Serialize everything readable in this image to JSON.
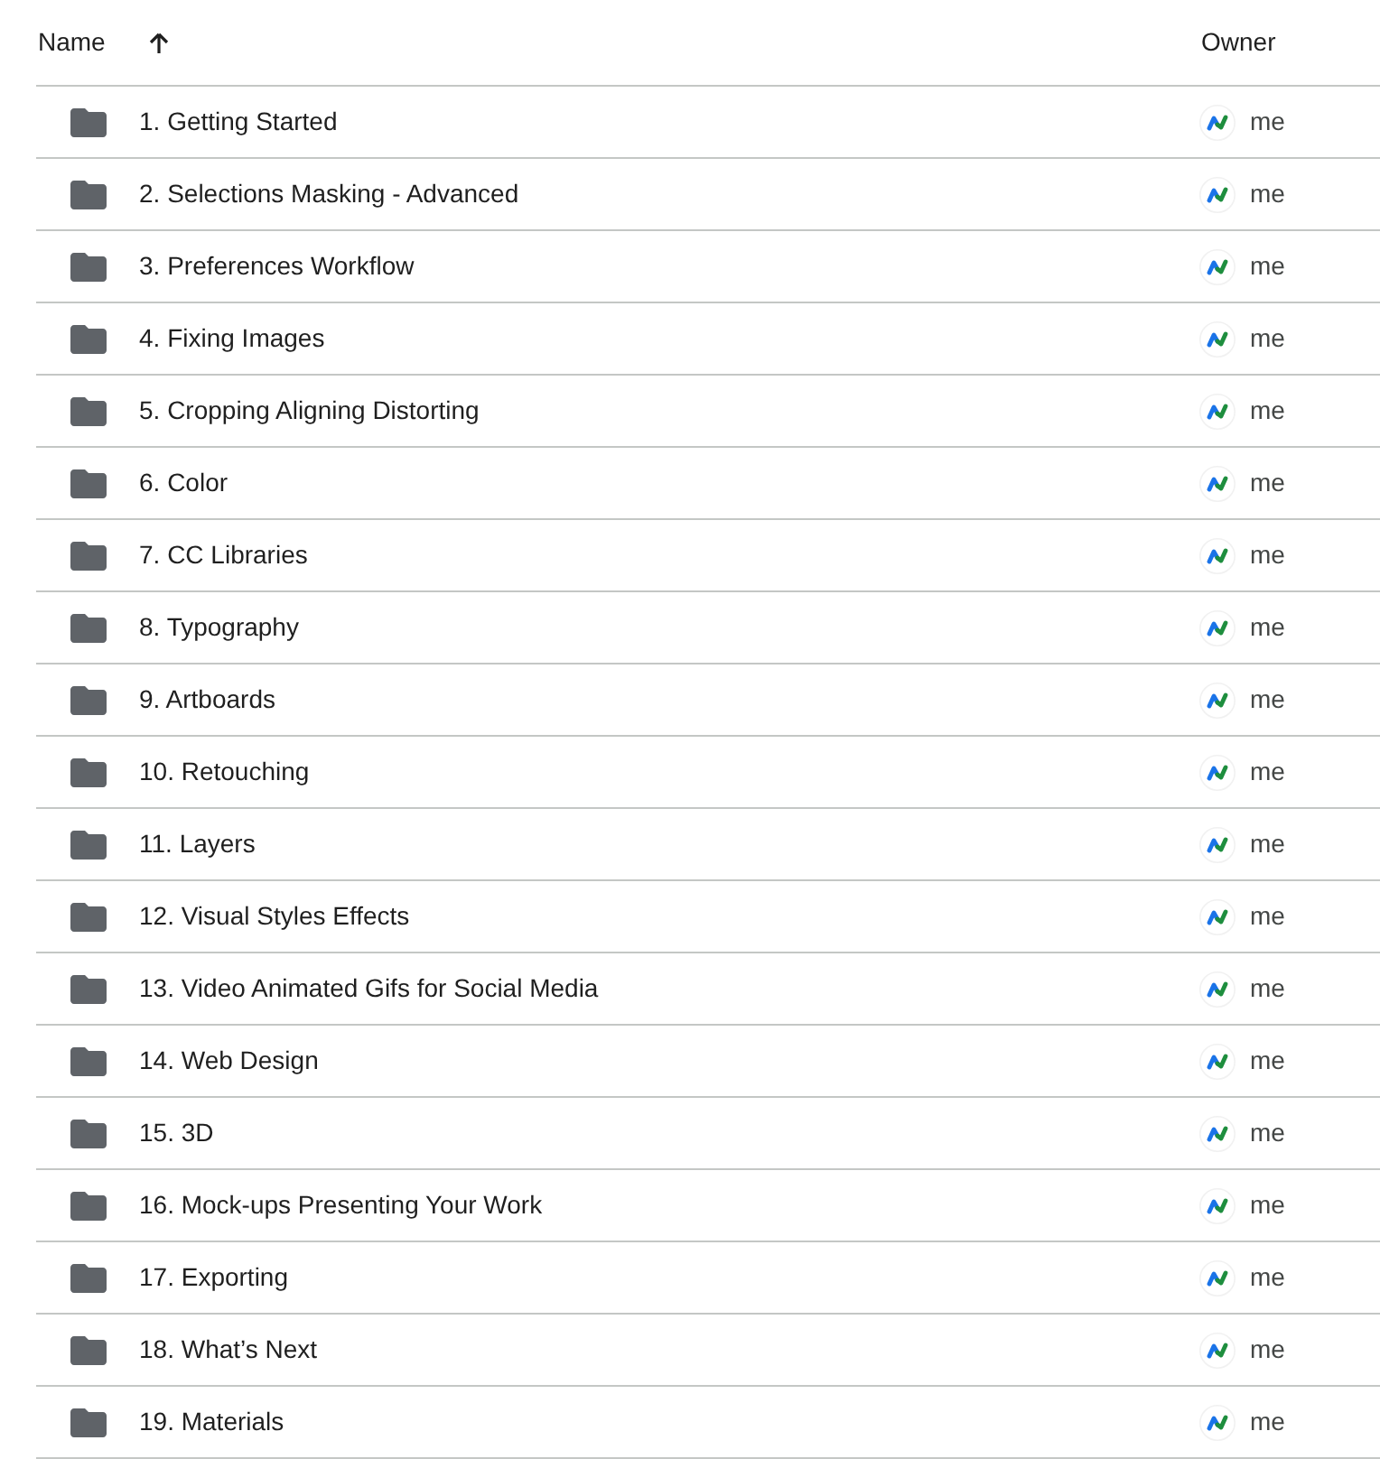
{
  "header": {
    "columns": [
      {
        "label": "Name",
        "sorted": true
      },
      {
        "label": "Owner",
        "sorted": false
      }
    ]
  },
  "rows": [
    {
      "name": "1. Getting Started",
      "owner": "me"
    },
    {
      "name": "2. Selections Masking - Advanced",
      "owner": "me"
    },
    {
      "name": "3. Preferences Workflow",
      "owner": "me"
    },
    {
      "name": "4. Fixing Images",
      "owner": "me"
    },
    {
      "name": "5. Cropping Aligning Distorting",
      "owner": "me"
    },
    {
      "name": "6. Color",
      "owner": "me"
    },
    {
      "name": "7. CC Libraries",
      "owner": "me"
    },
    {
      "name": "8. Typography",
      "owner": "me"
    },
    {
      "name": "9. Artboards",
      "owner": "me"
    },
    {
      "name": "10. Retouching",
      "owner": "me"
    },
    {
      "name": "11. Layers",
      "owner": "me"
    },
    {
      "name": "12. Visual Styles Effects",
      "owner": "me"
    },
    {
      "name": "13. Video Animated Gifs for Social Media",
      "owner": "me"
    },
    {
      "name": "14. Web Design",
      "owner": "me"
    },
    {
      "name": "15. 3D",
      "owner": "me"
    },
    {
      "name": "16. Mock-ups Presenting Your Work",
      "owner": "me"
    },
    {
      "name": "17. Exporting",
      "owner": "me"
    },
    {
      "name": "18. What’s Next",
      "owner": "me"
    },
    {
      "name": "19. Materials",
      "owner": "me"
    }
  ]
}
